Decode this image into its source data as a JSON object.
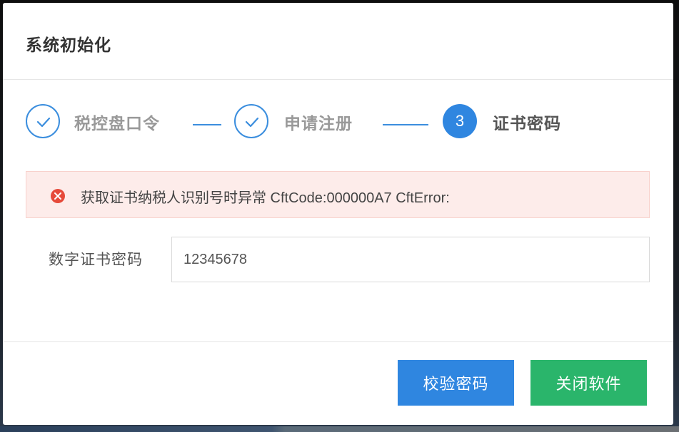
{
  "dialog": {
    "title": "系统初始化"
  },
  "steps": [
    {
      "label": "税控盘口令",
      "state": "done",
      "icon": "check-icon"
    },
    {
      "label": "申请注册",
      "state": "done",
      "icon": "check-icon"
    },
    {
      "label": "证书密码",
      "state": "active",
      "number": "3"
    }
  ],
  "alert": {
    "icon": "error-icon",
    "message": "获取证书纳税人识别号时异常 CftCode:000000A7 CftError:"
  },
  "form": {
    "cert_password_label": "数字证书密码",
    "cert_password_value": "12345678"
  },
  "buttons": {
    "verify_label": "校验密码",
    "close_label": "关闭软件"
  },
  "colors": {
    "primary": "#2f86e0",
    "success": "#2ab56b",
    "error": "#e64a3a",
    "alert_bg": "#fdecea"
  }
}
